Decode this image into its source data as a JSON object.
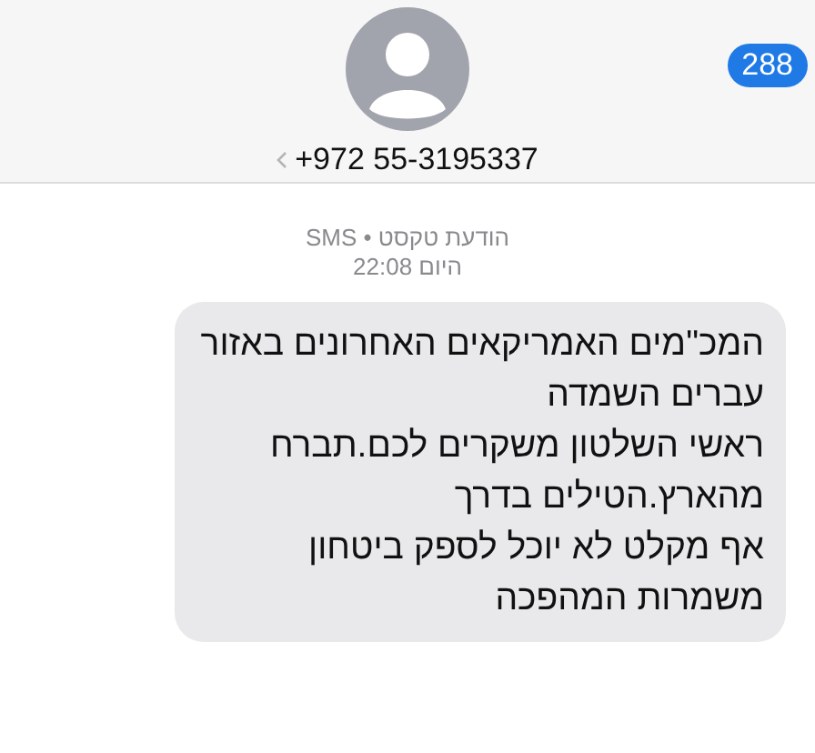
{
  "header": {
    "badge": "288",
    "contact": "+972 55-3195337"
  },
  "meta": {
    "service": "הודעת טקסט • SMS",
    "time": "היום 22:08"
  },
  "message": {
    "lines": [
      "המכ\"מים האמריקאים האחרונים באזור",
      "עברים השמדה",
      "ראשי השלטון משקרים לכם.תברח",
      "מהארץ.הטילים בדרך",
      "אף מקלט לא יוכל לספק ביטחון",
      "משמרות המהפכה"
    ]
  }
}
